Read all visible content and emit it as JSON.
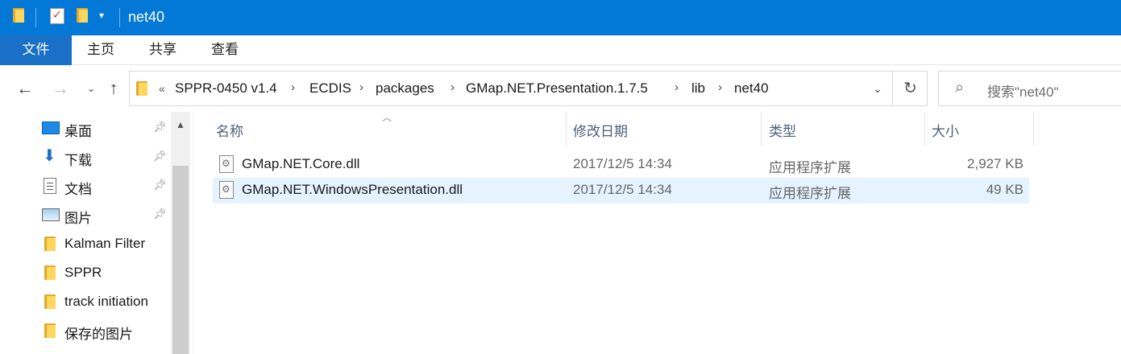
{
  "window": {
    "title": "net40"
  },
  "ribbon": {
    "tabs": [
      "文件",
      "主页",
      "共享",
      "查看"
    ]
  },
  "nav": {
    "breadcrumb_overflow": "«",
    "breadcrumb": [
      "SPPR-0450 v1.4",
      "ECDIS",
      "packages",
      "GMap.NET.Presentation.1.7.5",
      "lib",
      "net40"
    ],
    "search_placeholder": "搜索\"net40\""
  },
  "sidebar": {
    "items": [
      {
        "label": "桌面",
        "icon": "desktop-icon",
        "pinned": true
      },
      {
        "label": "下载",
        "icon": "download-icon",
        "pinned": true
      },
      {
        "label": "文档",
        "icon": "documents-icon",
        "pinned": true
      },
      {
        "label": "图片",
        "icon": "pictures-icon",
        "pinned": true
      },
      {
        "label": "Kalman Filter",
        "icon": "folder-icon",
        "pinned": false
      },
      {
        "label": "SPPR",
        "icon": "folder-icon",
        "pinned": false
      },
      {
        "label": "track initiation",
        "icon": "folder-icon",
        "pinned": false
      },
      {
        "label": "保存的图片",
        "icon": "folder-icon",
        "pinned": false
      }
    ]
  },
  "list": {
    "columns": [
      "名称",
      "修改日期",
      "类型",
      "大小"
    ],
    "rows": [
      {
        "name": "GMap.NET.Core.dll",
        "modified": "2017/12/5 14:34",
        "type": "应用程序扩展",
        "size": "2,927 KB",
        "selected": false
      },
      {
        "name": "GMap.NET.WindowsPresentation.dll",
        "modified": "2017/12/5 14:34",
        "type": "应用程序扩展",
        "size": "49 KB",
        "selected": true
      }
    ]
  },
  "colors": {
    "titlebar": "#0478d7",
    "file_tab": "#1a6fc6",
    "selection": "#e5f3ff"
  }
}
